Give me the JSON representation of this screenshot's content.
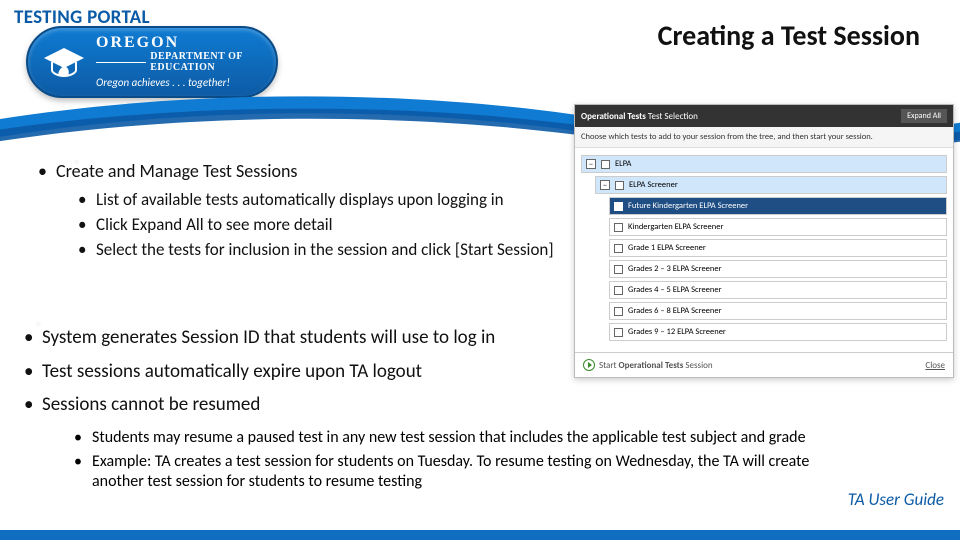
{
  "header": {
    "portal_label": "TESTING PORTAL",
    "title": "Creating a Test Session",
    "logo": {
      "oregon": "OREGON",
      "dept": "DEPARTMENT OF EDUCATION",
      "tagline": "Oregon achieves . . . together!"
    }
  },
  "bullets": {
    "b1": "Create and Manage Test Sessions",
    "b1_sub": {
      "a": "List of available tests automatically displays upon logging in",
      "b": "Click Expand All to see more detail",
      "c": "Select the tests for inclusion in the session and click [Start Session]"
    },
    "b2": "System generates Session ID that students will use to log in",
    "b3": "Test sessions automatically expire upon TA logout",
    "b4": "Sessions cannot be resumed",
    "b4_sub": {
      "a": "Students may resume a paused test in any new test session that includes the applicable test subject and grade",
      "b": "Example: TA creates a test session for students on Tuesday. To resume testing on Wednesday, the TA will create another test session for students to resume testing"
    }
  },
  "ta_link": "TA User Guide",
  "panel": {
    "header_a": "Operational Tests",
    "header_b": " Test Selection",
    "expand": "Expand All",
    "subtext": "Choose which tests to add to your session from the tree, and then start your session.",
    "rows": {
      "elpa": "ELPA",
      "screener": "ELPA Screener",
      "fk": "Future Kindergarten ELPA Screener",
      "kg": "Kindergarten ELPA Screener",
      "g1": "Grade 1 ELPA Screener",
      "g23": "Grades 2 – 3 ELPA Screener",
      "g45": "Grades 4 – 5 ELPA Screener",
      "g68": "Grades 6 – 8 ELPA Screener",
      "g912": "Grades 9 – 12 ELPA Screener"
    },
    "start_a": "Start ",
    "start_b": "Operational Tests",
    "start_c": " Session",
    "close": "Close"
  }
}
